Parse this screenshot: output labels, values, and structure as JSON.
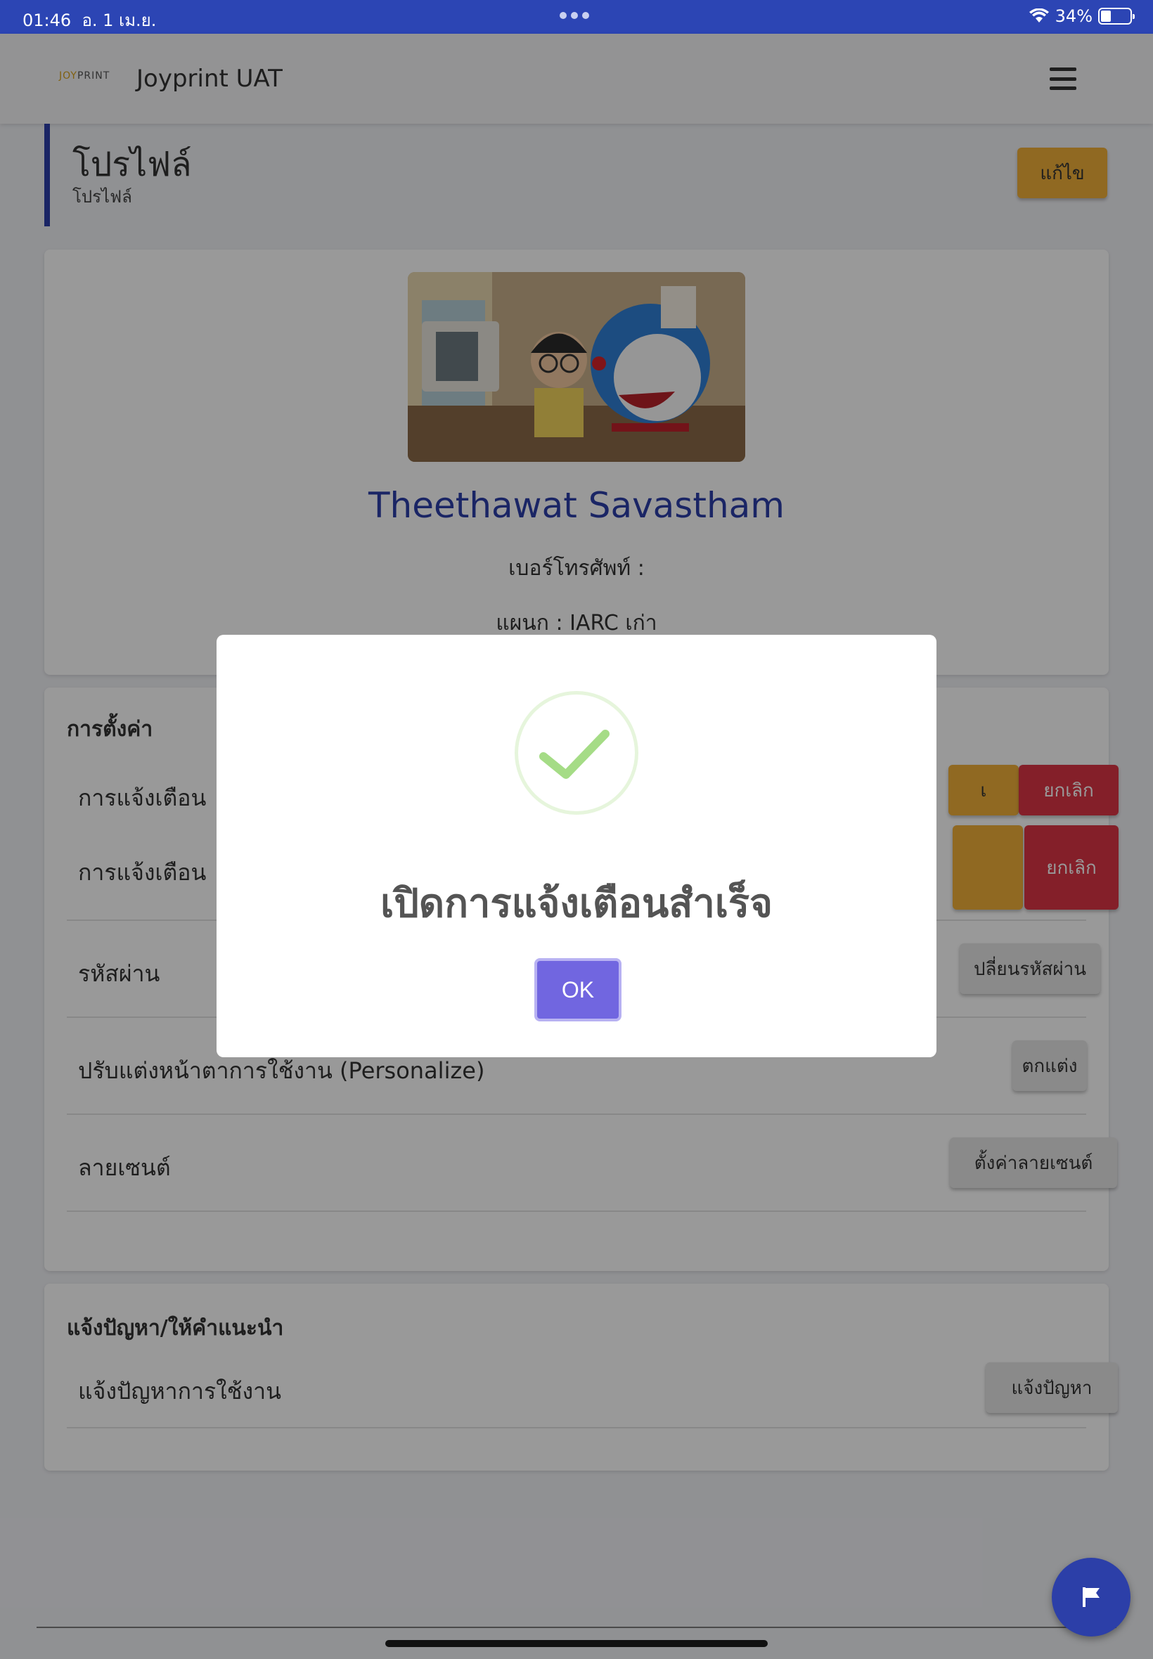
{
  "status_bar": {
    "time": "01:46",
    "date": "อ. 1 เม.ย.",
    "battery": "34%"
  },
  "header": {
    "logo": "JOYPRINT",
    "app_title": "Joyprint UAT"
  },
  "page": {
    "title": "โปรไฟล์",
    "subtitle": "โปรไฟล์",
    "edit_button": "แก้ไข"
  },
  "profile": {
    "name": "Theethawat Savastham",
    "phone_label": "เบอร์โทรศัพท์ :",
    "department_label": "แผนก : IARC เก่า"
  },
  "settings": {
    "title": "การตั้งค่า",
    "notify_row_1": {
      "label": "การแจ้งเตือน",
      "yellow_button": "เ",
      "cancel_button": "ยกเลิก"
    },
    "notify_row_2": {
      "label": "การแจ้งเตือน",
      "cancel_button": "ยกเลิก"
    },
    "password": {
      "label": "รหัสผ่าน",
      "button": "ปลี่ยนรหัสผ่าน"
    },
    "personalize": {
      "label": "ปรับแต่งหน้าตาการใช้งาน (Personalize)",
      "button": "ตกแต่ง"
    },
    "license": {
      "label": "ลายเซนต์",
      "button": "ตั้งค่าลายเซนต์"
    }
  },
  "report": {
    "title": "แจ้งปัญหา/ให้คำแนะนำ",
    "row_label": "แจ้งปัญหาการใช้งาน",
    "button": "แจ้งปัญหา"
  },
  "modal": {
    "title": "เปิดการแจ้งเตือนสำเร็จ",
    "ok_button": "OK"
  },
  "colors": {
    "primary": "#2c3fa8",
    "warning": "#f0b03a",
    "danger": "#dc3545",
    "success": "#a5dc86",
    "ok_button": "#7166e0"
  }
}
